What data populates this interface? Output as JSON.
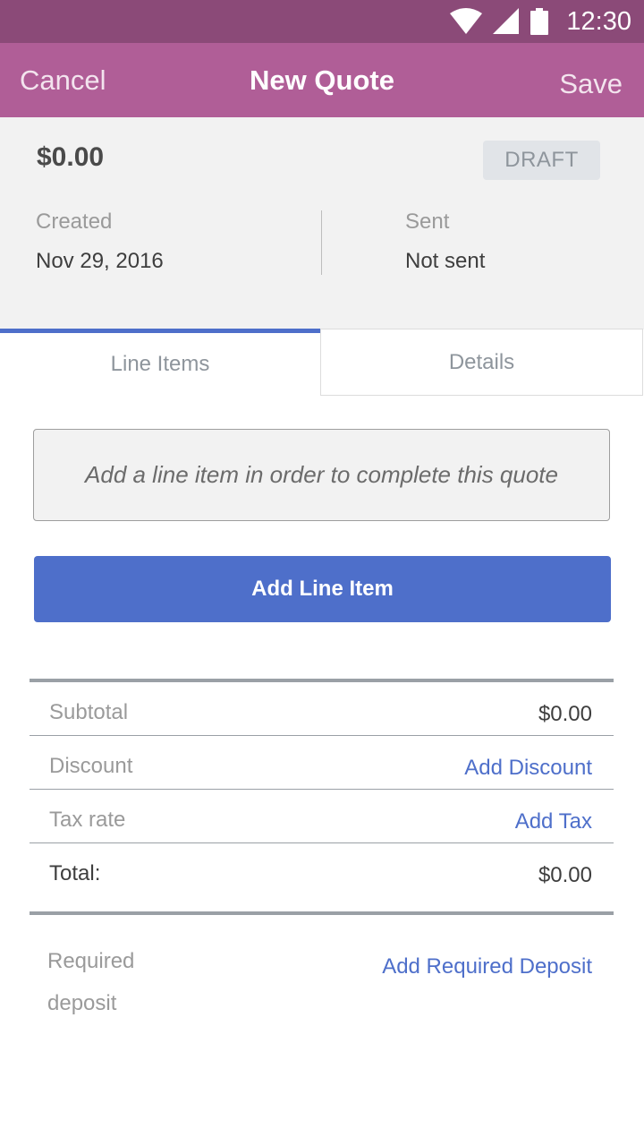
{
  "status_bar": {
    "time": "12:30",
    "icons": [
      "wifi-icon",
      "signal-icon",
      "battery-icon"
    ]
  },
  "app_bar": {
    "cancel_label": "Cancel",
    "title": "New Quote",
    "save_label": "Save"
  },
  "summary": {
    "amount": "$0.00",
    "status_badge": "DRAFT",
    "created_label": "Created",
    "created_value": "Nov 29, 2016",
    "sent_label": "Sent",
    "sent_value": "Not sent"
  },
  "tabs": [
    {
      "label": "Line Items",
      "active": true
    },
    {
      "label": "Details",
      "active": false
    }
  ],
  "notice": "Add a line item in order to complete this quote",
  "add_line_item_label": "Add Line Item",
  "totals": {
    "subtotal_label": "Subtotal",
    "subtotal_value": "$0.00",
    "discount_label": "Discount",
    "discount_action": "Add Discount",
    "tax_label": "Tax rate",
    "tax_action": "Add Tax",
    "total_label": "Total:",
    "total_value": "$0.00"
  },
  "deposit": {
    "label": "Required deposit",
    "action": "Add Required Deposit"
  },
  "colors": {
    "status_bar": "#8b4a78",
    "app_bar": "#b05e97",
    "accent": "#4e6fca"
  }
}
